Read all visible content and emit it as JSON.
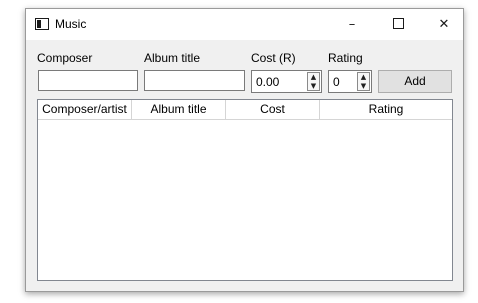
{
  "window": {
    "title": "Music",
    "icon": "app-window-icon",
    "controls": {
      "minimize": "–",
      "maximize_icon": "maximize-icon",
      "close": "✕"
    }
  },
  "form": {
    "composer_label": "Composer",
    "album_label": "Album title",
    "cost_label": "Cost (R)",
    "rating_label": "Rating",
    "composer_value": "",
    "album_value": "",
    "cost_value": "0.00",
    "rating_value": "0",
    "spin_up": "▲",
    "spin_down": "▼",
    "add_label": "Add"
  },
  "table": {
    "columns": [
      "Composer/artist",
      "Album title",
      "Cost",
      "Rating"
    ],
    "rows": []
  }
}
